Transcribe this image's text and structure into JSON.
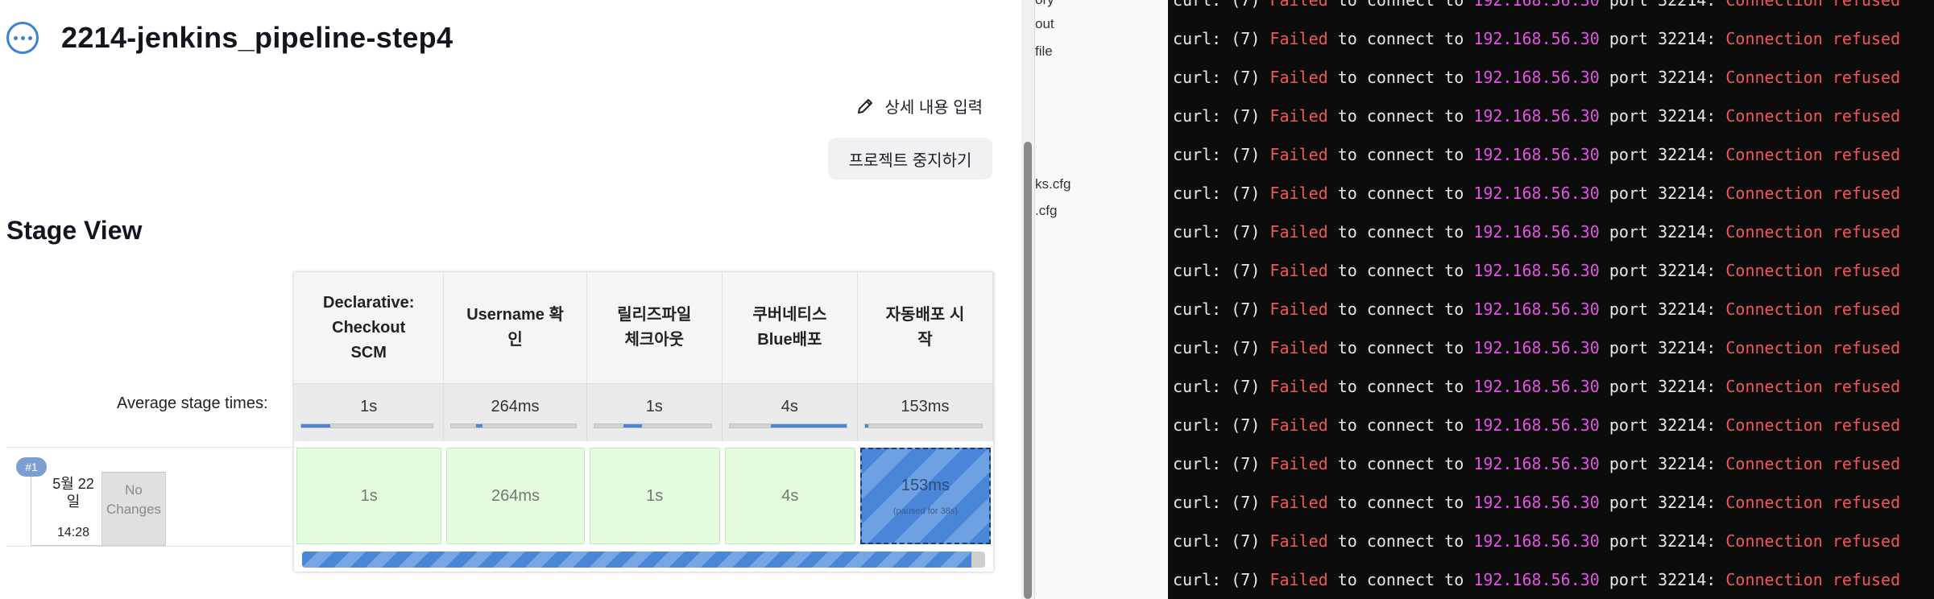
{
  "job": {
    "title": "2214-jenkins_pipeline-step4",
    "edit_description": "상세 내용 입력",
    "stop_project": "프로젝트 중지하기"
  },
  "stage_view": {
    "title": "Stage View",
    "avg_label": "Average stage times:",
    "stages": [
      {
        "name": "Declarative:\nCheckout\nSCM",
        "avg": "1s",
        "avg_fraction": 0.22,
        "cell": "1s"
      },
      {
        "name": "Username 확\n인",
        "avg": "264ms",
        "avg_fraction": 0.05,
        "cell": "264ms"
      },
      {
        "name": "릴리즈파일\n체크아웃",
        "avg": "1s",
        "avg_fraction": 0.16,
        "cell": "1s"
      },
      {
        "name": "쿠버네티스\nBlue배포",
        "avg": "4s",
        "avg_fraction": 0.65,
        "cell": "4s"
      },
      {
        "name": "자동배포 시\n작",
        "avg": "153ms",
        "avg_fraction": 0.03,
        "cell": "153ms",
        "note": "(paused for 38s)"
      }
    ],
    "build": {
      "number": "#1",
      "date": "5월 22\n일",
      "time": "14:28",
      "changes": "No\nChanges"
    },
    "progress_fraction": 0.98
  },
  "files": [
    "ory",
    "out",
    "file",
    "ks.cfg",
    ".cfg"
  ],
  "terminal": {
    "line": {
      "prefix": "curl: (7) ",
      "failed": "Failed",
      "mid": " to connect to ",
      "ip": "192.168.56.30",
      "port": " port 32214: ",
      "error": "Connection refused"
    },
    "line_count": 16,
    "colors": {
      "red": "#f0575a",
      "magenta": "#e452e4"
    }
  }
}
